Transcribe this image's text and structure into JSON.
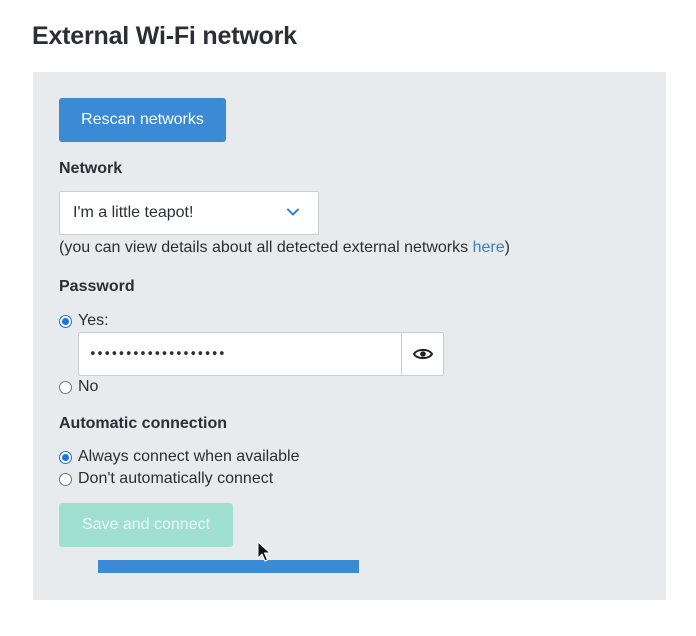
{
  "page": {
    "title": "External Wi-Fi network"
  },
  "actions": {
    "rescan_label": "Rescan networks",
    "save_label": "Save and connect"
  },
  "network": {
    "label": "Network",
    "selected": "I'm a little teapot!",
    "hint_before": "(you can view details about all detected external networks ",
    "hint_link": "here",
    "hint_after": ")"
  },
  "password": {
    "label": "Password",
    "yes_label": "Yes:",
    "no_label": "No",
    "value": "•••••••••••••••••••",
    "yes_checked": true
  },
  "auto_connect": {
    "label": "Automatic connection",
    "always_label": "Always connect when available",
    "never_label": "Don't automatically connect",
    "always_checked": true
  },
  "icons": {
    "select_chevron": "chevron-down-icon",
    "password_toggle": "eye-icon",
    "pointer": "mouse-cursor-icon"
  },
  "colors": {
    "primary": "#3b8ad5",
    "disabled_button": "#9fe0d1",
    "panel": "#e8ebee",
    "link": "#3b7fc4"
  }
}
